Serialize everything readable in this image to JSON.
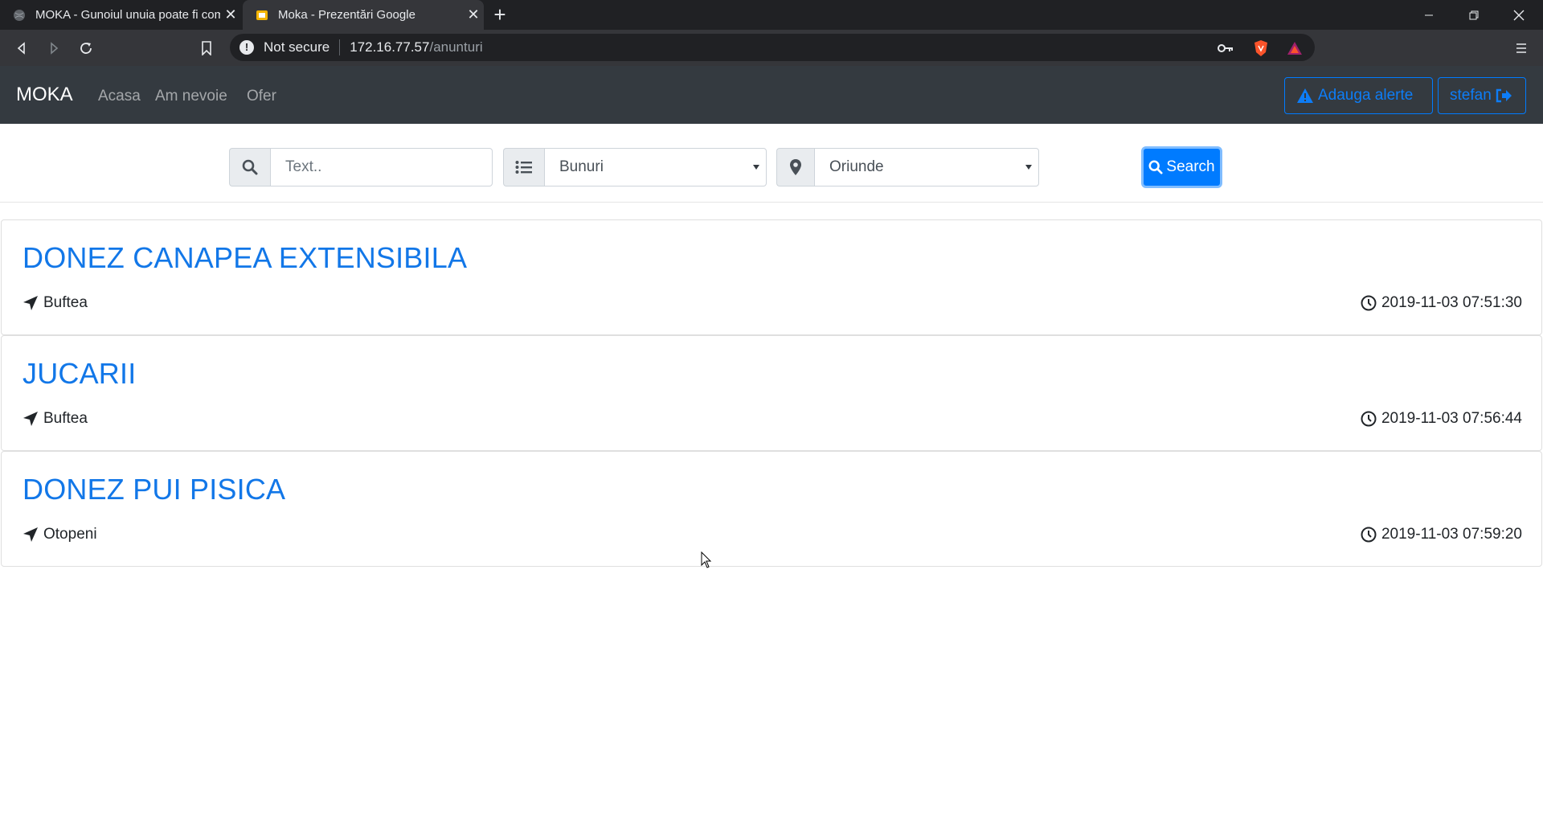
{
  "browser": {
    "tabs": [
      {
        "title": "MOKA - Gunoiul unuia poate fi comoara altuia",
        "active": false
      },
      {
        "title": "Moka - Prezentări Google",
        "active": true
      }
    ],
    "address": {
      "security_label": "Not secure",
      "host": "172.16.77.57",
      "path": "/anunturi"
    }
  },
  "navbar": {
    "brand": "MOKA",
    "links": [
      "Acasa",
      "Am nevoie",
      "Ofer"
    ],
    "alert_button": "Adauga alerte",
    "user_button": "stefan"
  },
  "search": {
    "text_placeholder": "Text..",
    "category_value": "Bunuri",
    "location_value": "Oriunde",
    "button_label": "Search"
  },
  "listings": [
    {
      "title": "DONEZ CANAPEA EXTENSIBILA",
      "location": "Buftea",
      "time": "2019-11-03 07:51:30"
    },
    {
      "title": "JUCARII",
      "location": "Buftea",
      "time": "2019-11-03 07:56:44"
    },
    {
      "title": "DONEZ PUI PISICA",
      "location": "Otopeni",
      "time": "2019-11-03 07:59:20"
    }
  ],
  "colors": {
    "navbar_bg": "#343a40",
    "link_blue": "#007bff",
    "chrome_dark": "#202124"
  }
}
